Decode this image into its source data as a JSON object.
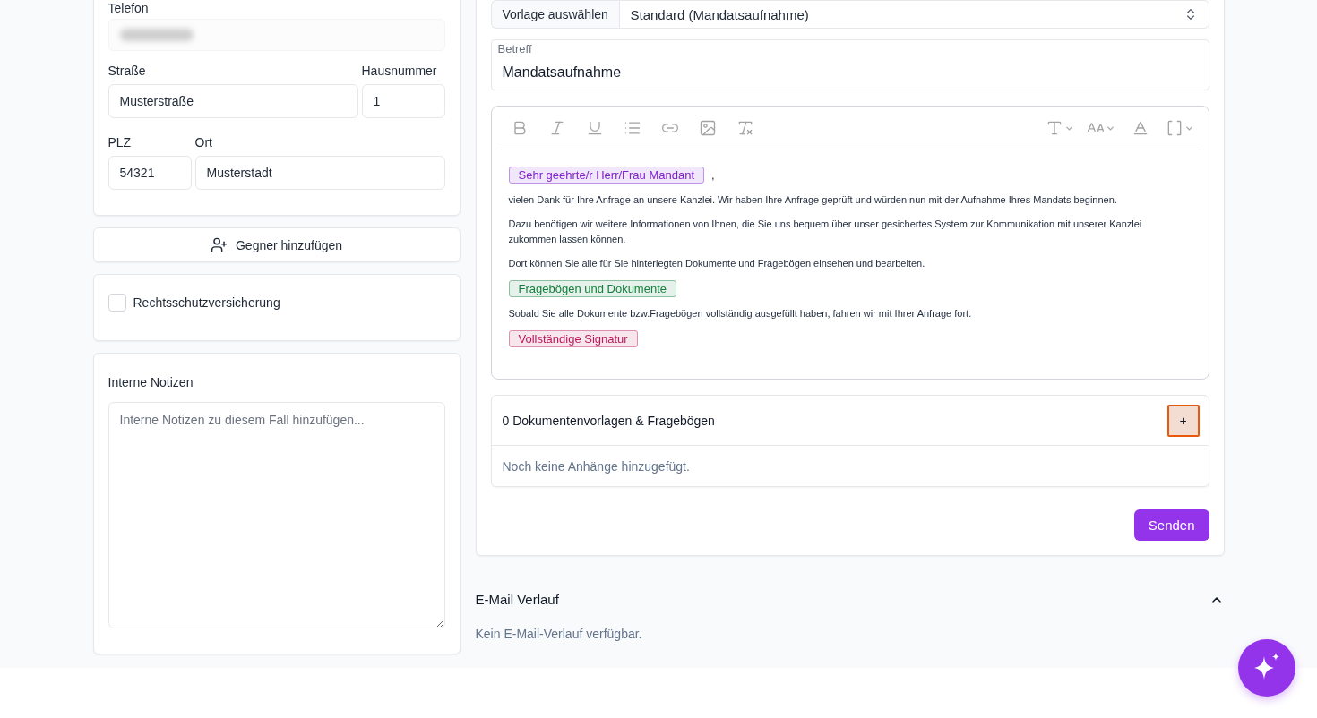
{
  "contact_card": {
    "phone": {
      "label": "Telefon",
      "value_blurred": true
    },
    "fields": [
      {
        "label": "Straße",
        "value": "Musterstraße"
      },
      {
        "label": "Hausnummer",
        "value": "1"
      },
      {
        "label": "PLZ",
        "value": "54321"
      },
      {
        "label": "Ort",
        "value": "Musterstadt"
      }
    ]
  },
  "add_opponent_button": {
    "label": "Gegner hinzufügen"
  },
  "insurance": {
    "label": "Rechtsschutzversicherung",
    "checked": false
  },
  "notes": {
    "label": "Interne Notizen",
    "placeholder": "Interne Notizen zu diesem Fall hinzufügen..."
  },
  "template_select": {
    "label": "Vorlage auswählen",
    "value": "Standard (Mandatsaufnahme)"
  },
  "subject": {
    "label": "Betreff",
    "value": "Mandatsaufnahme"
  },
  "editor": {
    "blocks": [
      {
        "kind": "tag",
        "text": "Sehr geehrte/r Herr/Frau Mandant",
        "color": "#7e22ce",
        "after": ","
      },
      {
        "kind": "paragraph",
        "text": "vielen Dank für Ihre Anfrage an unsere Kanzlei. Wir haben Ihre Anfrage geprüft und würden nun mit der Aufnahme Ihres Mandats beginnen."
      },
      {
        "kind": "paragraph",
        "text": "Dazu benötigen wir weitere Informationen von Ihnen, die Sie uns bequem über unser gesichertes System zur Kommunikation mit unserer Kanzlei zukommen lassen können."
      },
      {
        "kind": "paragraph",
        "text": "Dort können Sie alle für Sie hinterlegten Dokumente und Fragebögen einsehen und bearbeiten."
      },
      {
        "kind": "tag",
        "text": "Fragebögen und Dokumente",
        "color": "#15803d"
      },
      {
        "kind": "paragraph",
        "text": "Sobald Sie alle Dokumente bzw.Fragebögen vollständig ausgefüllt haben, fahren wir mit Ihrer Anfrage fort."
      },
      {
        "kind": "tag",
        "text": "Vollständige Signatur",
        "color": "#be185d"
      }
    ]
  },
  "attachments": {
    "title": "0 Dokumentenvorlagen & Fragebögen",
    "add_button": {
      "label": "+",
      "focused": true
    },
    "empty_text": "Noch keine Anhänge hinzugefügt."
  },
  "send_button": {
    "label": "Senden"
  },
  "email_history": {
    "title": "E-Mail Verlauf",
    "expanded": true,
    "empty_text": "Kein E-Mail-Verlauf verfügbar."
  }
}
